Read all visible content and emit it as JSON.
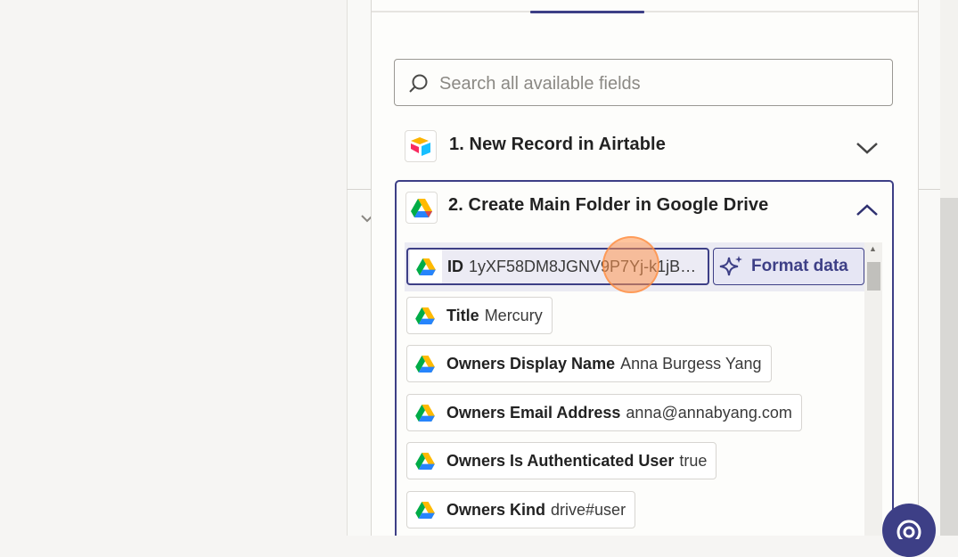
{
  "search": {
    "placeholder": "Search all available fields"
  },
  "steps": [
    {
      "title": "1. New Record in Airtable",
      "icon": "airtable-logo",
      "expanded": false
    },
    {
      "title": "2. Create Main Folder in Google Drive",
      "icon": "google-drive-logo",
      "expanded": true
    }
  ],
  "fields": [
    {
      "key": "ID",
      "value": "1yXF58DM8JGNV9P7Yj-k1jB…",
      "selected": true
    },
    {
      "key": "Title",
      "value": "Mercury"
    },
    {
      "key": "Owners Display Name",
      "value": "Anna Burgess Yang"
    },
    {
      "key": "Owners Email Address",
      "value": "anna@annabyang.com"
    },
    {
      "key": "Owners Is Authenticated User",
      "value": "true"
    },
    {
      "key": "Owners Kind",
      "value": "drive#user"
    }
  ],
  "format_button": {
    "label": "Format data"
  },
  "colors": {
    "accent": "#3d3f86",
    "cursor_highlight": "#ff9650"
  }
}
